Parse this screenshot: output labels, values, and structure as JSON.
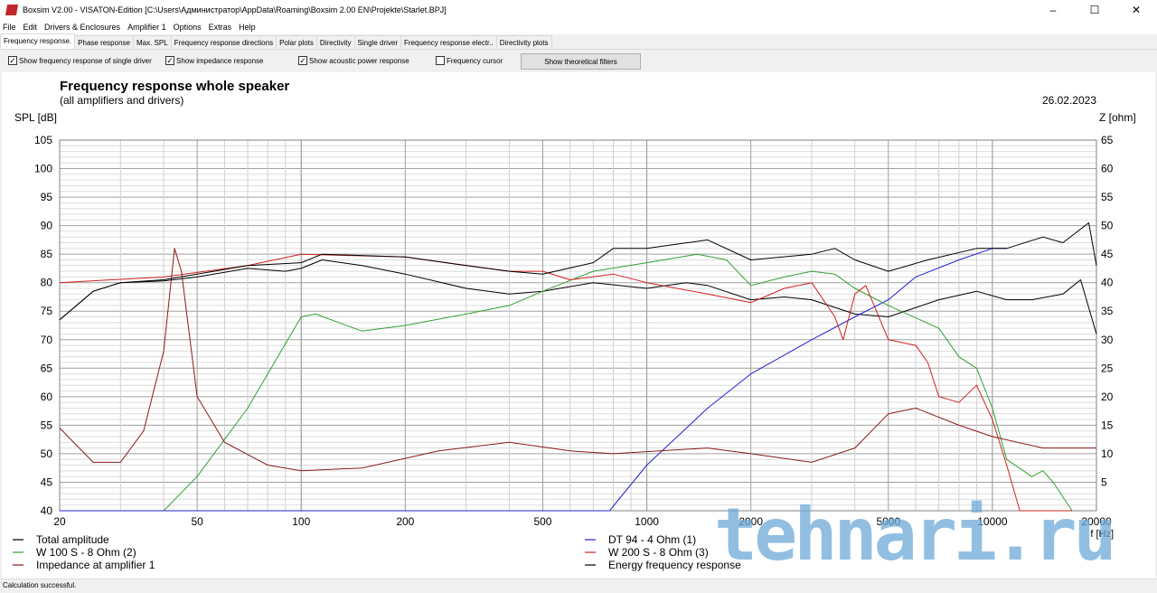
{
  "window": {
    "title": "Boxsim V2.00 - VISATON-Edition [C:\\Users\\Администратор\\AppData\\Roaming\\Boxsim 2.00 EN\\Projekte\\Starlet.BPJ]"
  },
  "menu": [
    "File",
    "Edit",
    "Drivers & Enclosures",
    "Amplifier 1",
    "Options",
    "Extras",
    "Help"
  ],
  "tabs": [
    "Frequency response.",
    "Phase response",
    "Max. SPL",
    "Frequency response directions",
    "Polar plots",
    "Directivity",
    "Single driver",
    "Frequency response electr..",
    "Directivity plots"
  ],
  "toolbar": {
    "cb1": "Show frequency response of single driver",
    "cb2": "Show impedance response",
    "cb3": "Show acoustic power response",
    "cb4": "Frequency cursor",
    "button": "Show theoretical filters"
  },
  "status": "Calculation successful.",
  "watermark": "tehnari.ru",
  "chart_data": {
    "type": "line",
    "title": "Frequency response whole speaker",
    "subtitle": "(all amplifiers and drivers)",
    "date": "26.02.2023",
    "ylabel": "SPL [dB]",
    "y2label": "Z [ohm]",
    "xlabel": "f [Hz]",
    "xlim": [
      20,
      20000
    ],
    "ylim": [
      40,
      105
    ],
    "y2lim": [
      0,
      65
    ],
    "xticks": [
      20,
      50,
      100,
      200,
      500,
      1000,
      2000,
      5000,
      10000,
      20000
    ],
    "yticks": [
      40,
      45,
      50,
      55,
      60,
      65,
      70,
      75,
      80,
      85,
      90,
      95,
      100,
      105
    ],
    "y2ticks": [
      5,
      10,
      15,
      20,
      25,
      30,
      35,
      40,
      45,
      50,
      55,
      60,
      65
    ],
    "series": [
      {
        "name": "Total amplitude",
        "color": "#000000",
        "axis": "spl",
        "points": [
          [
            20,
            73.5
          ],
          [
            25,
            78.5
          ],
          [
            30,
            80
          ],
          [
            40,
            80.3
          ],
          [
            50,
            81
          ],
          [
            70,
            82.5
          ],
          [
            90,
            82
          ],
          [
            100,
            82.5
          ],
          [
            115,
            84
          ],
          [
            150,
            83
          ],
          [
            200,
            81.5
          ],
          [
            300,
            79
          ],
          [
            400,
            78
          ],
          [
            500,
            78.5
          ],
          [
            700,
            80
          ],
          [
            1000,
            79
          ],
          [
            1300,
            80
          ],
          [
            1500,
            79.5
          ],
          [
            2000,
            77
          ],
          [
            2500,
            77.5
          ],
          [
            3000,
            77
          ],
          [
            4000,
            74.5
          ],
          [
            5000,
            74
          ],
          [
            7000,
            77
          ],
          [
            9000,
            78.5
          ],
          [
            11000,
            77
          ],
          [
            13000,
            77
          ],
          [
            16000,
            78
          ],
          [
            18000,
            80.5
          ],
          [
            20000,
            71
          ]
        ]
      },
      {
        "name": "DT 94 - 4 Ohm (1)",
        "color": "#2020d0",
        "axis": "spl",
        "points": [
          [
            20,
            40
          ],
          [
            780,
            40
          ],
          [
            1000,
            48
          ],
          [
            1500,
            58
          ],
          [
            2000,
            64
          ],
          [
            3000,
            70
          ],
          [
            4000,
            74
          ],
          [
            5000,
            77
          ],
          [
            6000,
            81
          ],
          [
            8000,
            84
          ],
          [
            10000,
            86
          ],
          [
            11000,
            86
          ]
        ]
      },
      {
        "name": "W 100 S - 8 Ohm (2)",
        "color": "#30a030",
        "axis": "spl",
        "points": [
          [
            40,
            40
          ],
          [
            50,
            46
          ],
          [
            70,
            58
          ],
          [
            100,
            74
          ],
          [
            110,
            74.5
          ],
          [
            150,
            71.5
          ],
          [
            200,
            72.5
          ],
          [
            300,
            74.5
          ],
          [
            400,
            76
          ],
          [
            500,
            78.5
          ],
          [
            700,
            82
          ],
          [
            1000,
            83.5
          ],
          [
            1400,
            85
          ],
          [
            1700,
            84
          ],
          [
            2000,
            79.5
          ],
          [
            2500,
            81
          ],
          [
            3000,
            82
          ],
          [
            3500,
            81.5
          ],
          [
            4000,
            79
          ],
          [
            5000,
            76
          ],
          [
            7000,
            72
          ],
          [
            8000,
            67
          ],
          [
            9000,
            65
          ],
          [
            10000,
            58
          ],
          [
            11000,
            49
          ],
          [
            13000,
            46
          ],
          [
            14000,
            47
          ],
          [
            15000,
            45
          ],
          [
            17000,
            40
          ]
        ]
      },
      {
        "name": "W 200 S - 8 Ohm (3)",
        "color": "#d02020",
        "axis": "spl",
        "points": [
          [
            20,
            80
          ],
          [
            40,
            81
          ],
          [
            70,
            83
          ],
          [
            100,
            85
          ],
          [
            200,
            84.5
          ],
          [
            400,
            82
          ],
          [
            500,
            82
          ],
          [
            600,
            80.5
          ],
          [
            800,
            81.5
          ],
          [
            1000,
            80
          ],
          [
            1500,
            78
          ],
          [
            2000,
            76.5
          ],
          [
            2500,
            79
          ],
          [
            3000,
            80
          ],
          [
            3500,
            74
          ],
          [
            3700,
            70
          ],
          [
            4000,
            78
          ],
          [
            4300,
            79.5
          ],
          [
            5000,
            70
          ],
          [
            6000,
            69
          ],
          [
            6500,
            66
          ],
          [
            7000,
            60
          ],
          [
            8000,
            59
          ],
          [
            9000,
            62
          ],
          [
            10000,
            56
          ],
          [
            11000,
            48
          ],
          [
            12000,
            40
          ],
          [
            17000,
            40
          ]
        ]
      },
      {
        "name": "Impedance at amplifier 1",
        "color": "#8b1a1a",
        "axis": "z",
        "points": [
          [
            20,
            14.5
          ],
          [
            25,
            8.5
          ],
          [
            30,
            8.5
          ],
          [
            35,
            14
          ],
          [
            40,
            28
          ],
          [
            43,
            46
          ],
          [
            45,
            42
          ],
          [
            50,
            20
          ],
          [
            60,
            12
          ],
          [
            80,
            8
          ],
          [
            100,
            7
          ],
          [
            150,
            7.5
          ],
          [
            250,
            10.5
          ],
          [
            400,
            12
          ],
          [
            600,
            10.5
          ],
          [
            800,
            10
          ],
          [
            1500,
            11
          ],
          [
            2000,
            10
          ],
          [
            3000,
            8.5
          ],
          [
            4000,
            11
          ],
          [
            5000,
            17
          ],
          [
            6000,
            18
          ],
          [
            8000,
            15
          ],
          [
            10000,
            13
          ],
          [
            14000,
            11
          ],
          [
            20000,
            11
          ]
        ]
      },
      {
        "name": "Energy frequency response",
        "color": "#000000",
        "axis": "spl",
        "points": [
          [
            20,
            73.5
          ],
          [
            25,
            78.5
          ],
          [
            30,
            80
          ],
          [
            40,
            80.5
          ],
          [
            50,
            81.5
          ],
          [
            70,
            83
          ],
          [
            100,
            83.5
          ],
          [
            115,
            85
          ],
          [
            200,
            84.5
          ],
          [
            300,
            83
          ],
          [
            400,
            82
          ],
          [
            500,
            81.5
          ],
          [
            700,
            83.5
          ],
          [
            800,
            86
          ],
          [
            1000,
            86
          ],
          [
            1500,
            87.5
          ],
          [
            2000,
            84
          ],
          [
            3000,
            85
          ],
          [
            3500,
            86
          ],
          [
            4000,
            84
          ],
          [
            5000,
            82
          ],
          [
            6500,
            84
          ],
          [
            9000,
            86
          ],
          [
            11000,
            86
          ],
          [
            14000,
            88
          ],
          [
            16000,
            87
          ],
          [
            19000,
            90.5
          ],
          [
            20000,
            83
          ]
        ]
      }
    ],
    "legend": [
      {
        "label": "Total amplitude",
        "color": "#000000"
      },
      {
        "label": "W 100 S - 8 Ohm (2)",
        "color": "#30a030"
      },
      {
        "label": "Impedance at amplifier 1",
        "color": "#8b1a1a"
      },
      {
        "label": "DT 94 - 4 Ohm (1)",
        "color": "#2020d0"
      },
      {
        "label": "W 200 S - 8 Ohm (3)",
        "color": "#d02020"
      },
      {
        "label": "Energy frequency response",
        "color": "#000000"
      }
    ]
  }
}
